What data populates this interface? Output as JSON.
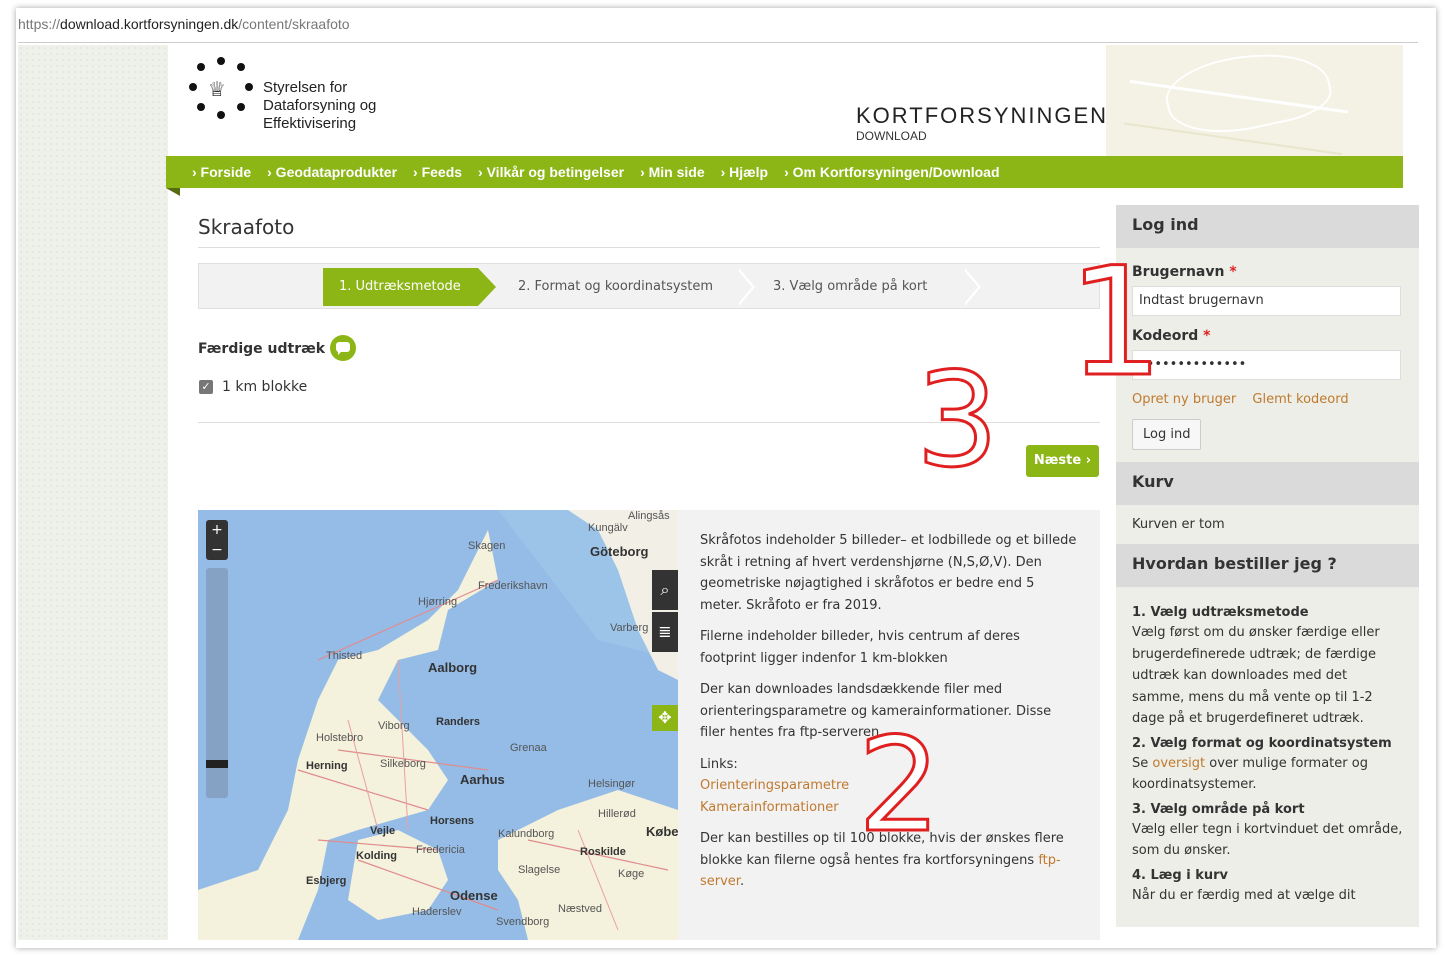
{
  "url": {
    "scheme": "https://",
    "host": "download.kortforsyningen.dk",
    "path": "/content/skraafoto"
  },
  "header": {
    "org_line1": "Styrelsen for",
    "org_line2": "Dataforsyning og",
    "org_line3": "Effektivisering",
    "brand": "KORTFORSYNINGEN",
    "brand_sub": "DOWNLOAD"
  },
  "nav": [
    "› Forside",
    "› Geodataprodukter",
    "› Feeds",
    "› Vilkår og betingelser",
    "› Min side",
    "› Hjælp",
    "› Om Kortforsyningen/Download"
  ],
  "main": {
    "title": "Skraafoto",
    "steps": [
      "1. Udtræksmetode",
      "2. Format og koordinatsystem",
      "3. Vælg område på kort"
    ],
    "section_label": "Færdige udtræk",
    "checkbox_label": "1 km blokke",
    "next_button": "Næste ›"
  },
  "map": {
    "zoom_in": "+",
    "zoom_out": "−",
    "cities": [
      "Skagen",
      "Frederikshavn",
      "Hjørring",
      "Thisted",
      "Aalborg",
      "Viborg",
      "Randers",
      "Holstebro",
      "Grenaa",
      "Herning",
      "Silkeborg",
      "Aarhus",
      "Helsingør",
      "Hillerød",
      "Vejle",
      "Horsens",
      "Kalundborg",
      "Fredericia",
      "Kolding",
      "Roskilde",
      "Slagelse",
      "Køge",
      "Esbjerg",
      "Odense",
      "Næstved",
      "Haderslev",
      "Svendborg",
      "Göteborg",
      "Kungälv",
      "Alingsås",
      "Varberg",
      "Københ"
    ]
  },
  "info": {
    "p1": "Skråfotos indeholder 5 billeder– et lodbillede og et billede skråt i retning af hvert verdenshjørne (N,S,Ø,V). Den geometriske nøjagtighed i skråfotos er bedre end 5 meter. Skråfoto er fra 2019.",
    "p2": "Filerne indeholder billeder, hvis centrum af deres footprint ligger indenfor 1 km-blokken",
    "p3": "Der kan downloades landsdækkende filer med orienteringsparametre og kamerainformationer. Disse filer hentes fra ftp-serveren.",
    "links_label": "Links:",
    "link1": "Orienteringsparametre",
    "link2": "Kamerainformationer",
    "p4_text": "Der kan bestilles op til 100 blokke, hvis der ønskes flere blokke kan filerne også hentes fra kortforsyningens ",
    "p4_link": "ftp-server",
    "p4_end": "."
  },
  "sidebar": {
    "login_title": "Log ind",
    "username_label": "Brugernavn",
    "username_value": "Indtast brugernavn",
    "password_label": "Kodeord",
    "password_value": "••••••••••••••",
    "create_user": "Opret ny bruger",
    "forgot": "Glemt kodeord",
    "login_button": "Log ind",
    "required_mark": "*",
    "cart_title": "Kurv",
    "cart_text": "Kurven er tom",
    "howto_title": "Hvordan bestiller jeg ?",
    "howto": [
      {
        "h": "1. Vælg udtræksmetode",
        "t": "Vælg først om du ønsker færdige eller brugerdefinerede udtræk; de færdige udtræk kan downloades med det samme, mens du må vente op til 1-2 dage på et brugerdefineret udtræk."
      },
      {
        "h": "2. Vælg format og koordinatsystem",
        "t_pre": "Se ",
        "t_link": "oversigt",
        "t_post": " over mulige formater og koordinatsystemer."
      },
      {
        "h": "3. Vælg område på kort",
        "t": "Vælg eller tegn i kortvinduet det område, som du ønsker."
      },
      {
        "h": "4. Læg i kurv",
        "t": "Når du er færdig med at vælge dit"
      }
    ]
  },
  "annotations": [
    "1",
    "2",
    "3"
  ],
  "colors": {
    "accent": "#8cb516",
    "link": "#c07a30",
    "annotation": "#e02020"
  }
}
